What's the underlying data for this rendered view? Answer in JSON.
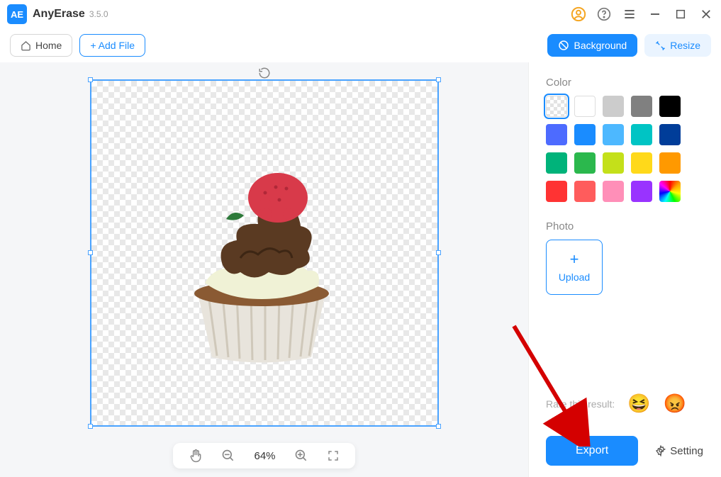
{
  "title": {
    "app_name": "AnyErase",
    "version": "3.5.0"
  },
  "toolbar": {
    "home_label": "Home",
    "add_file_label": "+ Add File",
    "background_label": "Background",
    "resize_label": "Resize"
  },
  "canvas": {
    "zoom_value": "64%"
  },
  "sidepanel": {
    "color_title": "Color",
    "photo_title": "Photo",
    "upload_label": "Upload",
    "rate_label": "Rate this result:",
    "setting_label": "Setting",
    "export_label": "Export",
    "colors": {
      "transparent": "transparent",
      "white": "#ffffff",
      "light_gray": "#cccccc",
      "gray": "#808080",
      "black": "#000000",
      "blue": "#4d6bff",
      "sky": "#1a8cff",
      "lightblue": "#4db8ff",
      "cyan": "#00c4c4",
      "navy": "#003d99",
      "teal": "#00b37a",
      "green": "#2bb84d",
      "lime": "#c4e01a",
      "yellow": "#ffd91a",
      "orange": "#ff9900",
      "red": "#ff3333",
      "coral": "#ff5c5c",
      "pink": "#ff8fb8",
      "purple": "#9933ff",
      "rainbow": "rainbow"
    }
  }
}
